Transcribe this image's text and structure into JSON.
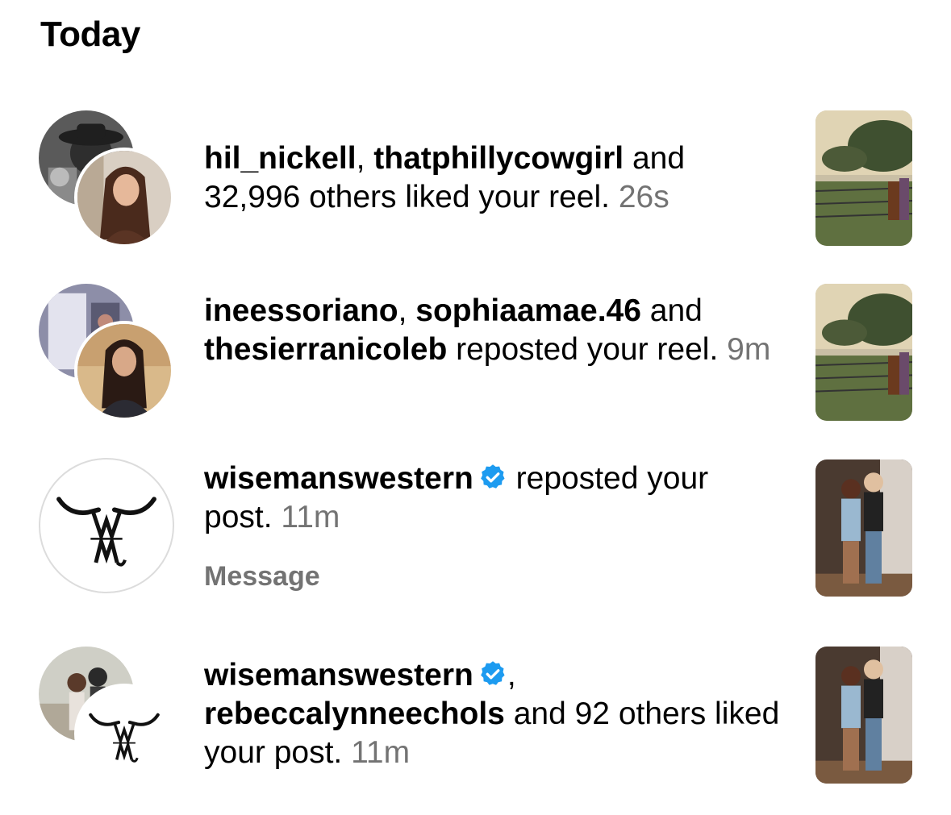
{
  "header": {
    "title": "Today"
  },
  "notifications": [
    {
      "user1": "hil_nickell",
      "sep": ", ",
      "user2": "thatphillycowgirl",
      "rest": " and 32,996 others liked your reel.",
      "time": "26s",
      "avatar_icons": [
        "cowboy-photo-avatar",
        "woman-photo-avatar"
      ],
      "thumbnail": "horse-field-thumbnail"
    },
    {
      "user1": "ineessoriano",
      "sep": ", ",
      "user2": "sophiaamae.46",
      "mid": " and ",
      "user3": "thesierranicoleb",
      "rest": " reposted your reel.",
      "time": "9m",
      "avatar_icons": [
        "room-photo-avatar",
        "woman-street-photo-avatar"
      ],
      "thumbnail": "horse-field-thumbnail"
    },
    {
      "user1": "wisemanswestern",
      "verified": true,
      "rest": " reposted your post.",
      "time": "11m",
      "action_label": "Message",
      "avatar_icons": [
        "longhorn-logo-avatar"
      ],
      "thumbnail": "couple-photo-thumbnail"
    },
    {
      "user1": "wisemanswestern",
      "verified": true,
      "sep": ",",
      "user2": "rebeccalynneechols",
      "rest": " and 92 others liked your post.",
      "time": "11m",
      "avatar_icons": [
        "couple-photo-avatar",
        "longhorn-logo-avatar"
      ],
      "thumbnail": "couple-photo-thumbnail"
    }
  ],
  "colors": {
    "text": "#000000",
    "secondary": "#737373",
    "verified": "#1d9bf0"
  }
}
